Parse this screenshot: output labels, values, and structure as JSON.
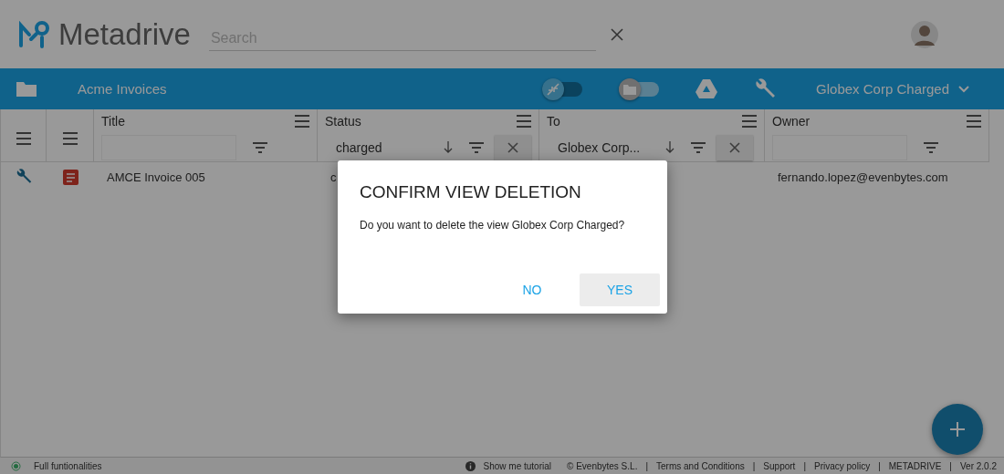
{
  "header": {
    "logo": "Metadrive",
    "search": {
      "placeholder": "Search"
    }
  },
  "toolbar": {
    "folder_name": "Acme Invoices",
    "toggles": [
      {
        "on": true
      },
      {
        "on": false
      }
    ],
    "view": "Globex Corp Charged"
  },
  "columns": [
    {
      "kind": "icon"
    },
    {
      "kind": "icon"
    },
    {
      "kind": "text",
      "title": "Title",
      "sorted": false,
      "clear": false
    },
    {
      "kind": "text",
      "title": "Status",
      "filter": "charged",
      "sorted": true,
      "clear": true
    },
    {
      "kind": "text",
      "title": "To",
      "filter": "Globex Corp...",
      "sorted": true,
      "clear": true
    },
    {
      "kind": "text",
      "title": "Owner",
      "sorted": false,
      "clear": false
    }
  ],
  "rows": [
    {
      "title": "AMCE Invoice 005",
      "status": "c",
      "owner": "fernando.lopez@evenbytes.com"
    }
  ],
  "dialog": {
    "title": "CONFIRM VIEW DELETION",
    "message": "Do you want to delete the view Globex Corp Charged?",
    "buttons": [
      {
        "label": "NO",
        "selected": false
      },
      {
        "label": "YES",
        "selected": true
      }
    ]
  },
  "footer": [
    {
      "kind": "status",
      "text": "Full funtionalities"
    },
    {
      "kind": "info",
      "text": "Show me tutorial"
    },
    {
      "kind": "text",
      "text": "© Evenbytes S.L."
    },
    {
      "kind": "sep",
      "text": "|"
    },
    {
      "kind": "link",
      "text": "Terms and Conditions"
    },
    {
      "kind": "sep",
      "text": "|"
    },
    {
      "kind": "link",
      "text": "Support"
    },
    {
      "kind": "sep",
      "text": "|"
    },
    {
      "kind": "link",
      "text": "Privacy policy"
    },
    {
      "kind": "sep",
      "text": "|"
    },
    {
      "kind": "link",
      "text": "METADRIVE"
    },
    {
      "kind": "sep",
      "text": "|"
    },
    {
      "kind": "text",
      "text": "Ver 2.0.2"
    }
  ]
}
